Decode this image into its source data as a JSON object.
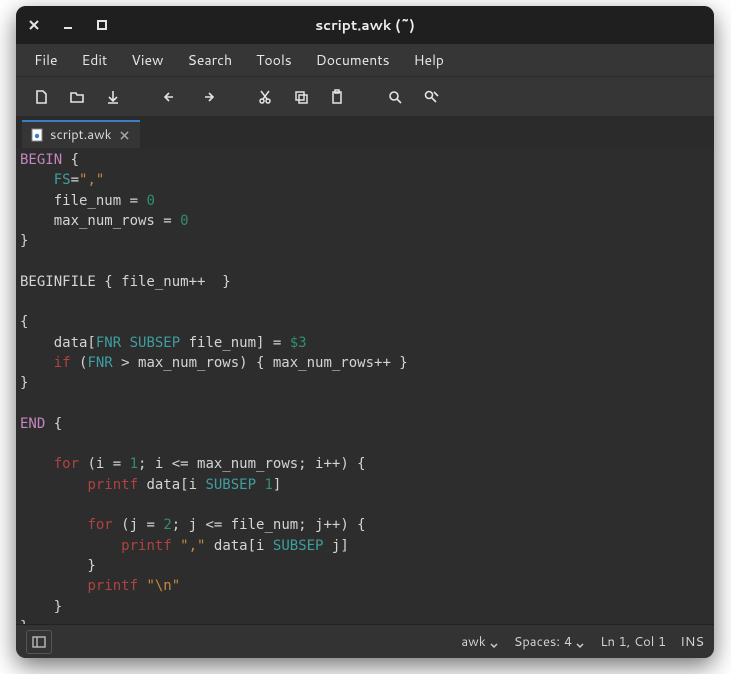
{
  "window": {
    "title": "script.awk (~)"
  },
  "menubar": [
    "File",
    "Edit",
    "View",
    "Search",
    "Tools",
    "Documents",
    "Help"
  ],
  "toolbar_icons": [
    "new-file-icon",
    "open-file-icon",
    "save-icon",
    "undo-icon",
    "redo-icon",
    "cut-icon",
    "copy-icon",
    "paste-icon",
    "search-icon",
    "find-replace-icon"
  ],
  "tab": {
    "label": "script.awk"
  },
  "code": {
    "lines": [
      [
        [
          "kw-block",
          "BEGIN"
        ],
        [
          "punct",
          " {"
        ]
      ],
      [
        [
          "punct",
          "    "
        ],
        [
          "var-sp",
          "FS"
        ],
        [
          "punct",
          "="
        ],
        [
          "str",
          "\",\""
        ]
      ],
      [
        [
          "punct",
          "    file_num = "
        ],
        [
          "num",
          "0"
        ]
      ],
      [
        [
          "punct",
          "    max_num_rows = "
        ],
        [
          "num",
          "0"
        ]
      ],
      [
        [
          "punct",
          "}"
        ]
      ],
      [
        [
          "punct",
          ""
        ]
      ],
      [
        [
          "punct",
          "BEGINFILE { file_num++  }"
        ]
      ],
      [
        [
          "punct",
          ""
        ]
      ],
      [
        [
          "punct",
          "{"
        ]
      ],
      [
        [
          "punct",
          "    data["
        ],
        [
          "var-sp",
          "FNR"
        ],
        [
          "punct",
          " "
        ],
        [
          "var-sp",
          "SUBSEP"
        ],
        [
          "punct",
          " file_num] = "
        ],
        [
          "num",
          "$3"
        ]
      ],
      [
        [
          "punct",
          "    "
        ],
        [
          "kw-flow",
          "if"
        ],
        [
          "punct",
          " ("
        ],
        [
          "var-sp",
          "FNR"
        ],
        [
          "punct",
          " > max_num_rows) { max_num_rows++ }"
        ]
      ],
      [
        [
          "punct",
          "}"
        ]
      ],
      [
        [
          "punct",
          ""
        ]
      ],
      [
        [
          "kw-block",
          "END"
        ],
        [
          "punct",
          " {"
        ]
      ],
      [
        [
          "punct",
          ""
        ]
      ],
      [
        [
          "punct",
          "    "
        ],
        [
          "kw-flow",
          "for"
        ],
        [
          "punct",
          " (i = "
        ],
        [
          "num",
          "1"
        ],
        [
          "punct",
          "; i <= max_num_rows; i++) {"
        ]
      ],
      [
        [
          "punct",
          "        "
        ],
        [
          "kw-flow",
          "printf"
        ],
        [
          "punct",
          " data[i "
        ],
        [
          "var-sp",
          "SUBSEP"
        ],
        [
          "punct",
          " "
        ],
        [
          "num",
          "1"
        ],
        [
          "punct",
          "]"
        ]
      ],
      [
        [
          "punct",
          ""
        ]
      ],
      [
        [
          "punct",
          "        "
        ],
        [
          "kw-flow",
          "for"
        ],
        [
          "punct",
          " (j = "
        ],
        [
          "num",
          "2"
        ],
        [
          "punct",
          "; j <= file_num; j++) {"
        ]
      ],
      [
        [
          "punct",
          "            "
        ],
        [
          "kw-flow",
          "printf"
        ],
        [
          "punct",
          " "
        ],
        [
          "str",
          "\",\""
        ],
        [
          "punct",
          " data[i "
        ],
        [
          "var-sp",
          "SUBSEP"
        ],
        [
          "punct",
          " j]"
        ]
      ],
      [
        [
          "punct",
          "        }"
        ]
      ],
      [
        [
          "punct",
          "        "
        ],
        [
          "kw-flow",
          "printf"
        ],
        [
          "punct",
          " "
        ],
        [
          "str",
          "\"\\n\""
        ]
      ],
      [
        [
          "punct",
          "    }"
        ]
      ],
      [
        [
          "punct",
          "}"
        ]
      ]
    ]
  },
  "status": {
    "language": "awk",
    "spaces_label": "Spaces:",
    "spaces_value": "4",
    "position": "Ln 1, Col 1",
    "insert_mode": "INS"
  }
}
